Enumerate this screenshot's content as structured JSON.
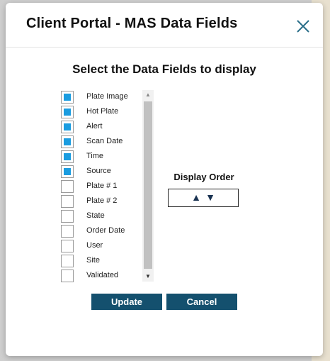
{
  "dialog": {
    "title": "Client Portal - MAS Data Fields",
    "section_title": "Select the Data Fields to display",
    "close_icon": "close-icon"
  },
  "fields": [
    {
      "label": "Plate Image",
      "checked": true
    },
    {
      "label": "Hot Plate",
      "checked": true
    },
    {
      "label": "Alert",
      "checked": true
    },
    {
      "label": "Scan Date",
      "checked": true
    },
    {
      "label": "Time",
      "checked": true
    },
    {
      "label": "Source",
      "checked": true
    },
    {
      "label": "Plate # 1",
      "checked": false
    },
    {
      "label": "Plate # 2",
      "checked": false
    },
    {
      "label": "State",
      "checked": false
    },
    {
      "label": "Order Date",
      "checked": false
    },
    {
      "label": "User",
      "checked": false
    },
    {
      "label": "Site",
      "checked": false
    },
    {
      "label": "Validated",
      "checked": false
    }
  ],
  "display_order": {
    "label": "Display Order",
    "up_icon": "arrow-up-icon",
    "down_icon": "arrow-down-icon"
  },
  "buttons": {
    "update": "Update",
    "cancel": "Cancel"
  },
  "colors": {
    "accent": "#14506e",
    "checkbox_fill": "#1a9ce0",
    "arrow": "#1a3352"
  }
}
